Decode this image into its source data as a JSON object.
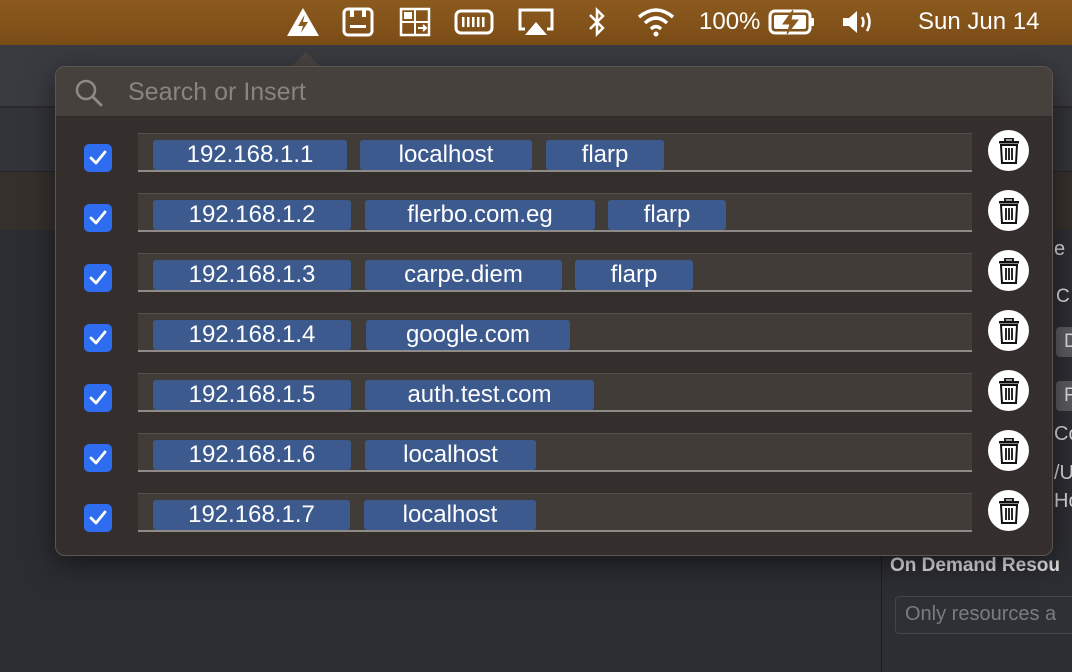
{
  "menubar": {
    "battery_percent": "100%",
    "clock": "Sun Jun 14",
    "icons": [
      "hosts-warning-icon",
      "pasteboard-icon",
      "screen-share-icon",
      "keyboard-icon",
      "airplay-icon",
      "bluetooth-icon",
      "wifi-icon",
      "battery-charging-icon",
      "volume-icon"
    ]
  },
  "popover": {
    "search_placeholder": "Search or Insert",
    "rows": [
      {
        "checked": true,
        "tokens": [
          "192.168.1.1",
          "localhost",
          "flarp"
        ]
      },
      {
        "checked": true,
        "tokens": [
          "192.168.1.2",
          "flerbo.com.eg",
          "flarp"
        ]
      },
      {
        "checked": true,
        "tokens": [
          "192.168.1.3",
          "carpe.diem",
          "flarp"
        ]
      },
      {
        "checked": true,
        "tokens": [
          "192.168.1.4",
          "google.com"
        ]
      },
      {
        "checked": true,
        "tokens": [
          "192.168.1.5",
          "auth.test.com"
        ]
      },
      {
        "checked": true,
        "tokens": [
          "192.168.1.6",
          "localhost"
        ]
      },
      {
        "checked": true,
        "tokens": [
          "192.168.1.7",
          "localhost"
        ]
      }
    ]
  },
  "background": {
    "right_fragments": [
      "e",
      "C",
      "D",
      "F",
      "Co",
      "/U",
      "Ho"
    ],
    "section_heading": "On Demand Resou",
    "field_text": "Only resources a"
  },
  "colors": {
    "menubar": "#8c5a1e",
    "token": "#3d5a8e",
    "checkbox": "#2e6cf0"
  }
}
